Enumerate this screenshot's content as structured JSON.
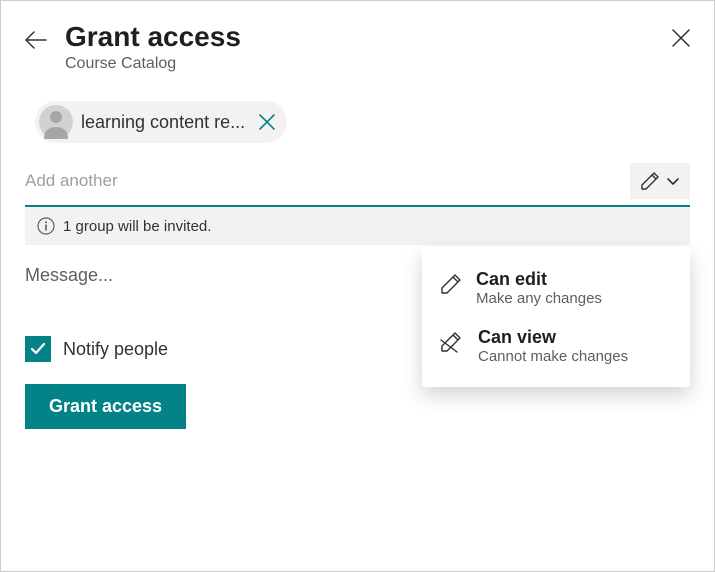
{
  "header": {
    "title": "Grant access",
    "subtitle": "Course Catalog"
  },
  "chip": {
    "label": "learning content re..."
  },
  "add_placeholder": "Add another",
  "info_text": "1 group will be invited.",
  "message_placeholder": "Message...",
  "notify_label": "Notify people",
  "notify_checked": true,
  "grant_label": "Grant access",
  "dropdown": {
    "items": [
      {
        "title": "Can edit",
        "sub": "Make any changes",
        "icon": "pencil"
      },
      {
        "title": "Can view",
        "sub": "Cannot make changes",
        "icon": "pencil-slash"
      }
    ]
  },
  "colors": {
    "accent": "#038387"
  }
}
